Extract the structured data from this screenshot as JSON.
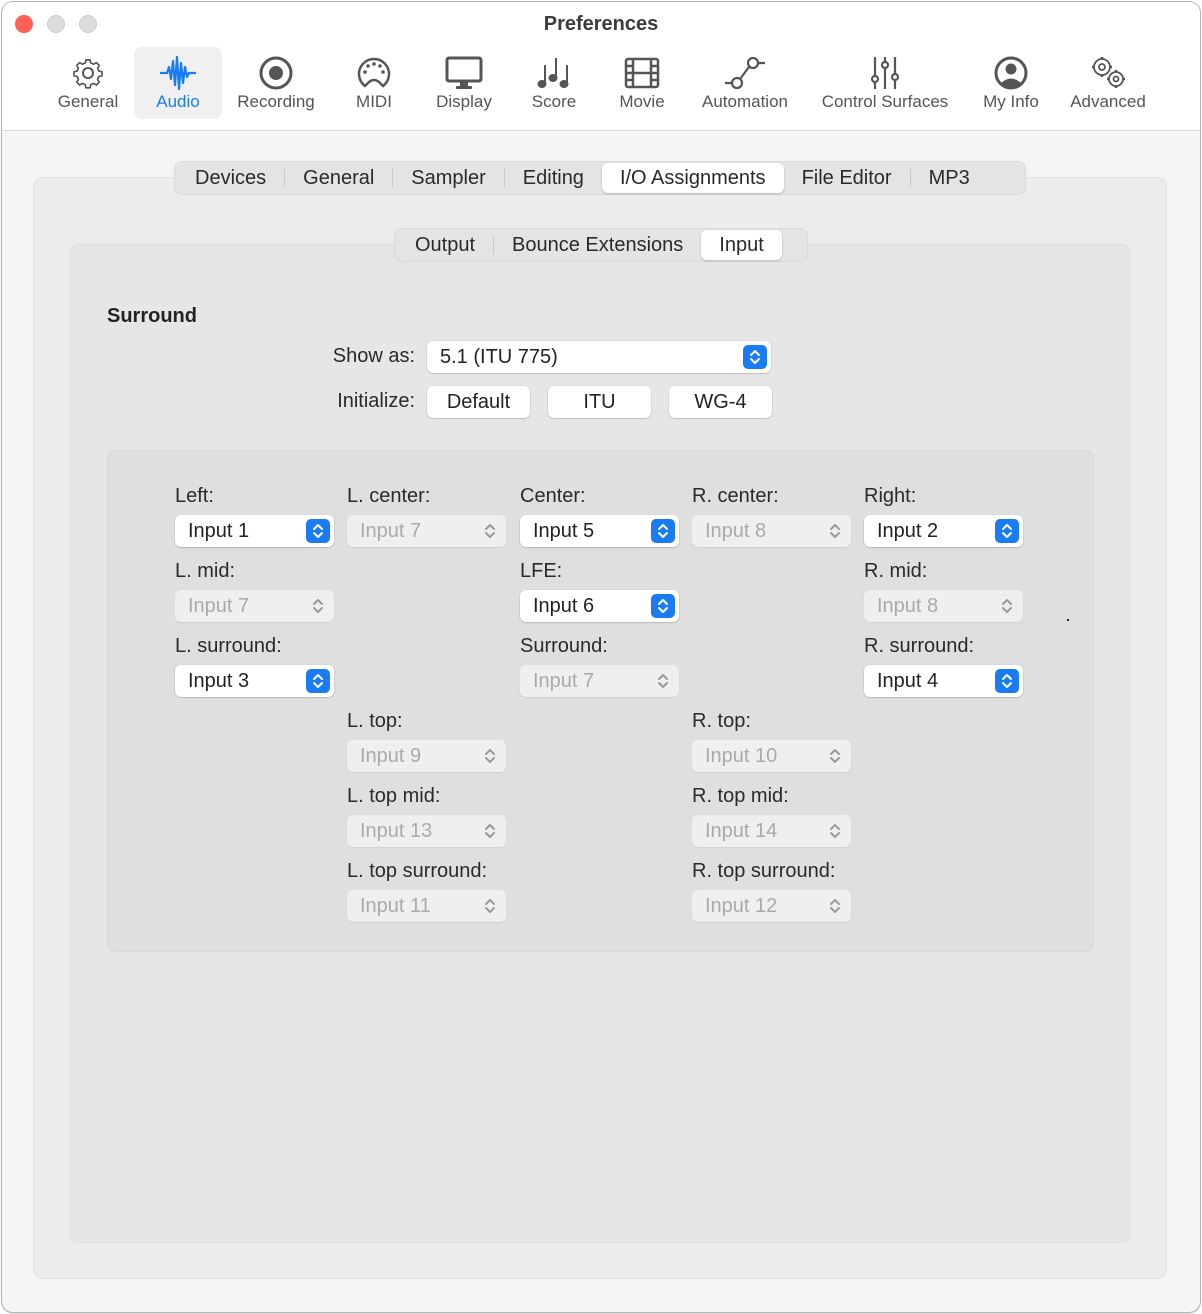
{
  "window": {
    "title": "Preferences"
  },
  "toolbar": {
    "items": [
      {
        "label": "General",
        "icon": "gear-icon",
        "active": false
      },
      {
        "label": "Audio",
        "icon": "waveform-icon",
        "active": true
      },
      {
        "label": "Recording",
        "icon": "record-icon",
        "active": false
      },
      {
        "label": "MIDI",
        "icon": "midi-port-icon",
        "active": false
      },
      {
        "label": "Display",
        "icon": "monitor-icon",
        "active": false
      },
      {
        "label": "Score",
        "icon": "music-notes-icon",
        "active": false
      },
      {
        "label": "Movie",
        "icon": "film-icon",
        "active": false
      },
      {
        "label": "Automation",
        "icon": "automation-curve-icon",
        "active": false
      },
      {
        "label": "Control Surfaces",
        "icon": "sliders-icon",
        "active": false
      },
      {
        "label": "My Info",
        "icon": "person-circle-icon",
        "active": false
      },
      {
        "label": "Advanced",
        "icon": "gears-icon",
        "active": false
      }
    ],
    "accent_color": "#1a7cf5"
  },
  "tabs": {
    "items": [
      "Devices",
      "General",
      "Sampler",
      "Editing",
      "I/O Assignments",
      "File Editor",
      "MP3"
    ],
    "selected": "I/O Assignments"
  },
  "subtabs": {
    "items": [
      "Output",
      "Bounce Extensions",
      "Input"
    ],
    "selected": "Input"
  },
  "surround": {
    "title": "Surround",
    "show_as_label": "Show as:",
    "show_as_value": "5.1 (ITU 775)",
    "initialize_label": "Initialize:",
    "initialize_buttons": [
      "Default",
      "ITU",
      "WG-4"
    ]
  },
  "channels": {
    "left": {
      "label": "Left:",
      "value": "Input 1",
      "enabled": true
    },
    "l_center": {
      "label": "L. center:",
      "value": "Input 7",
      "enabled": false
    },
    "center": {
      "label": "Center:",
      "value": "Input 5",
      "enabled": true
    },
    "r_center": {
      "label": "R. center:",
      "value": "Input 8",
      "enabled": false
    },
    "right": {
      "label": "Right:",
      "value": "Input 2",
      "enabled": true
    },
    "l_mid": {
      "label": "L. mid:",
      "value": "Input 7",
      "enabled": false
    },
    "lfe": {
      "label": "LFE:",
      "value": "Input 6",
      "enabled": true
    },
    "r_mid": {
      "label": "R. mid:",
      "value": "Input 8",
      "enabled": false
    },
    "l_surround": {
      "label": "L. surround:",
      "value": "Input 3",
      "enabled": true
    },
    "surround": {
      "label": "Surround:",
      "value": "Input 7",
      "enabled": false
    },
    "r_surround": {
      "label": "R. surround:",
      "value": "Input 4",
      "enabled": true
    },
    "l_top": {
      "label": "L. top:",
      "value": "Input 9",
      "enabled": false
    },
    "r_top": {
      "label": "R. top:",
      "value": "Input 10",
      "enabled": false
    },
    "l_top_mid": {
      "label": "L. top mid:",
      "value": "Input 13",
      "enabled": false
    },
    "r_top_mid": {
      "label": "R. top mid:",
      "value": "Input 14",
      "enabled": false
    },
    "l_top_surround": {
      "label": "L. top surround:",
      "value": "Input 11",
      "enabled": false
    },
    "r_top_surround": {
      "label": "R. top surround:",
      "value": "Input 12",
      "enabled": false
    }
  }
}
